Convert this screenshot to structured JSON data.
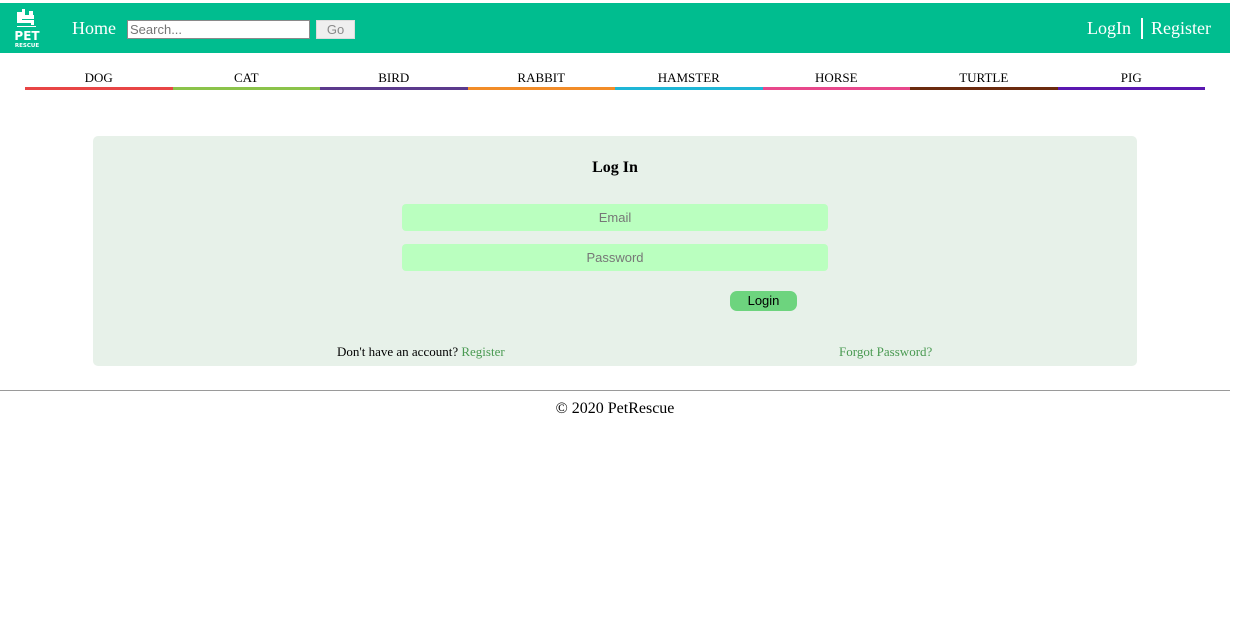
{
  "header": {
    "logo_alt": "PET RESCUE",
    "home_label": "Home",
    "search_placeholder": "Search...",
    "go_label": "Go",
    "login_label": "LogIn",
    "register_label": "Register",
    "bg_color": "#00bd8f"
  },
  "categories": [
    {
      "label": "DOG",
      "color": "#e84545"
    },
    {
      "label": "CAT",
      "color": "#8bc34a"
    },
    {
      "label": "BIRD",
      "color": "#5b3a8c"
    },
    {
      "label": "RABBIT",
      "color": "#f28c28"
    },
    {
      "label": "HAMSTER",
      "color": "#1eb6d6"
    },
    {
      "label": "HORSE",
      "color": "#e8478b"
    },
    {
      "label": "TURTLE",
      "color": "#6b2a0e"
    },
    {
      "label": "PIG",
      "color": "#5a17b0"
    }
  ],
  "login_form": {
    "title": "Log In",
    "email_placeholder": "Email",
    "password_placeholder": "Password",
    "submit_label": "Login",
    "no_account_text": "Don't have an account? ",
    "register_link": "Register",
    "forgot_link": "Forgot Password?"
  },
  "footer": {
    "copyright": "© 2020 PetRescue"
  }
}
